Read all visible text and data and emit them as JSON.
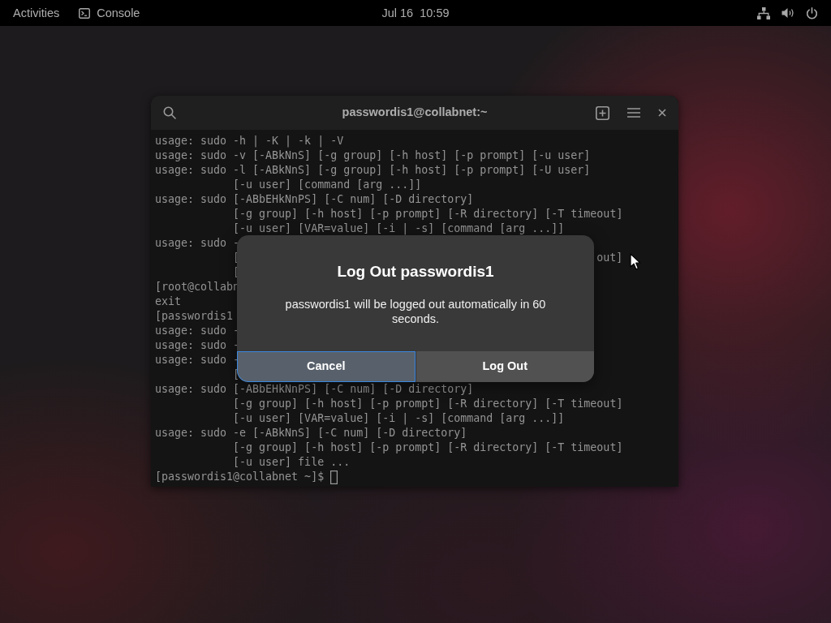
{
  "top_bar": {
    "activities": "Activities",
    "app_menu": "Console",
    "clock": "Jul 16  10:59"
  },
  "terminal": {
    "title": "passwordis1@collabnet:~",
    "lines": [
      {
        "text": "usage: sudo -h | -K | -k | -V",
        "continuation": false
      },
      {
        "text": "usage: sudo -v [-ABkNnS] [-g group] [-h host] [-p prompt] [-u user]",
        "continuation": false
      },
      {
        "text": "usage: sudo -l [-ABkNnS] [-g group] [-h host] [-p prompt] [-U user]",
        "continuation": false
      },
      {
        "text": "[-u user] [command [arg ...]]",
        "continuation": true
      },
      {
        "text": "usage: sudo [-ABbEHkNnPS] [-C num] [-D directory]",
        "continuation": false
      },
      {
        "text": "[-g group] [-h host] [-p prompt] [-R directory] [-T timeout]",
        "continuation": true
      },
      {
        "text": "[-u user] [VAR=value] [-i | -s] [command [arg ...]]",
        "continuation": true
      },
      {
        "text": "usage: sudo -",
        "continuation": false
      },
      {
        "text": "[",
        "continuation": true,
        "tail": "out]"
      },
      {
        "text": "[",
        "continuation": true
      },
      {
        "text": "[root@collabn",
        "continuation": false
      },
      {
        "text": "exit",
        "continuation": false
      },
      {
        "text": "[passwordis1",
        "continuation": false
      },
      {
        "text": "usage: sudo -",
        "continuation": false
      },
      {
        "text": "usage: sudo -",
        "continuation": false
      },
      {
        "text": "usage: sudo -",
        "continuation": false
      },
      {
        "text": "[",
        "continuation": true
      },
      {
        "text": "usage: sudo [-ABbEHkNnPS] [-C num] [-D directory]",
        "continuation": false
      },
      {
        "text": "[-g group] [-h host] [-p prompt] [-R directory] [-T timeout]",
        "continuation": true
      },
      {
        "text": "[-u user] [VAR=value] [-i | -s] [command [arg ...]]",
        "continuation": true
      },
      {
        "text": "usage: sudo -e [-ABkNnS] [-C num] [-D directory]",
        "continuation": false
      },
      {
        "text": "[-g group] [-h host] [-p prompt] [-R directory] [-T timeout]",
        "continuation": true
      },
      {
        "text": "[-u user] file ...",
        "continuation": true
      }
    ],
    "prompt": "[passwordis1@collabnet ~]$"
  },
  "dialog": {
    "title": "Log Out passwordis1",
    "message": "passwordis1 will be logged out automatically in 60 seconds.",
    "buttons": [
      {
        "label": "Cancel",
        "focused": true
      },
      {
        "label": "Log Out",
        "focused": false
      }
    ]
  }
}
